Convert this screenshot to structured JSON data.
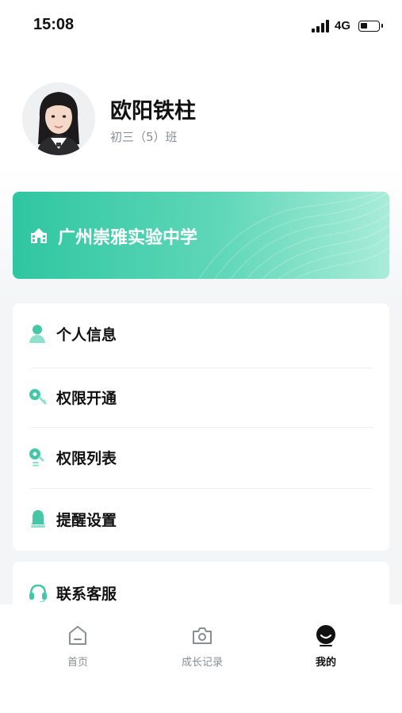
{
  "status_bar": {
    "time": "15:08",
    "network": "4G"
  },
  "profile": {
    "name": "欧阳铁柱",
    "class": "初三（5）班"
  },
  "school": {
    "name": "广州崇雅实验中学"
  },
  "menu": {
    "items": [
      {
        "label": "个人信息",
        "icon": "person-icon"
      },
      {
        "label": "权限开通",
        "icon": "key-icon"
      },
      {
        "label": "权限列表",
        "icon": "key-list-icon"
      },
      {
        "label": "提醒设置",
        "icon": "bell-icon"
      }
    ],
    "contact": {
      "label": "联系客服",
      "icon": "headset-icon"
    }
  },
  "tabs": [
    {
      "label": "首页",
      "icon": "home-icon"
    },
    {
      "label": "成长记录",
      "icon": "camera-icon"
    },
    {
      "label": "我的",
      "icon": "profile-face-icon",
      "active": true
    }
  ],
  "colors": {
    "accent": "#2fc6a1",
    "accent_light": "#5fd7b8",
    "text": "#111111",
    "muted": "#8a8d93"
  }
}
